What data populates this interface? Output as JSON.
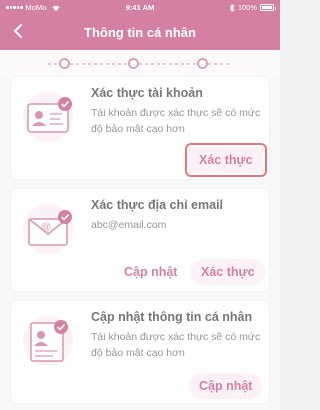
{
  "status_bar": {
    "carrier": "MoMo",
    "time": "9:41 AM",
    "battery": "100%"
  },
  "nav": {
    "title": "Thông tin cá nhân"
  },
  "stepper": {
    "steps": 3
  },
  "cards": [
    {
      "title": "Xác thực tài khoản",
      "description": "Tài khoản được xác thực sẽ có mức độ bảo mật cao hơn",
      "primary_button": "Xác thực"
    },
    {
      "title": "Xác thực địa chỉ email",
      "description": "abc@email.com",
      "secondary_button": "Cập nhật",
      "primary_button": "Xác thực"
    },
    {
      "title": "Cập nhật thông tin cá nhân",
      "description": "Tài khoản được xác thực sẽ có mức độ bảo mật cao hơn",
      "primary_button": "Cập nhật"
    }
  ],
  "colors": {
    "brand": "#b8336a",
    "button_bg": "#fbe9f1",
    "highlight": "#e21d2a"
  }
}
